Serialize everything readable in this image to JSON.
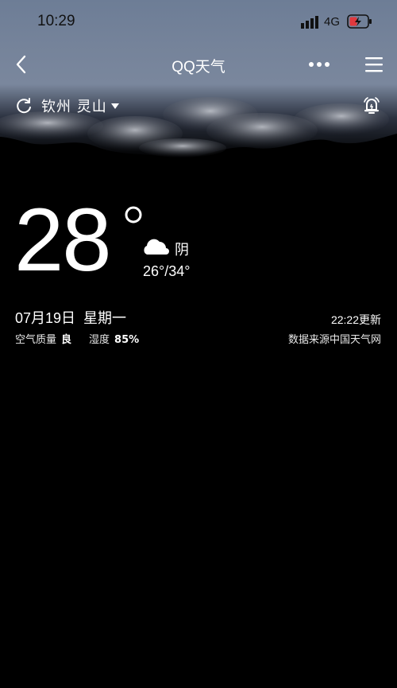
{
  "status_bar": {
    "time": "10:29",
    "network": "4G",
    "icons": [
      "signal-bars-icon",
      "battery-charging-icon"
    ]
  },
  "nav": {
    "title": "QQ天气",
    "icons": [
      "chevron-left-icon",
      "more-dots-icon",
      "hamburger-menu-icon"
    ]
  },
  "location": {
    "name": "钦州 灵山",
    "icons": [
      "refresh-icon",
      "dropdown-triangle-icon",
      "alarm-bell-icon"
    ]
  },
  "weather": {
    "temperature": "28",
    "condition": "阴",
    "condition_icon": "cloud-icon",
    "range": "26°/34°",
    "date": "07月19日  星期一",
    "updated": "22:22更新",
    "air_quality_label": "空气质量",
    "air_quality_value": "良",
    "humidity_label": "湿度",
    "humidity_value": "85%",
    "source": "数据来源中国天气网"
  },
  "colors": {
    "background": "#000000",
    "header": "#75839a",
    "text": "#ffffff"
  }
}
